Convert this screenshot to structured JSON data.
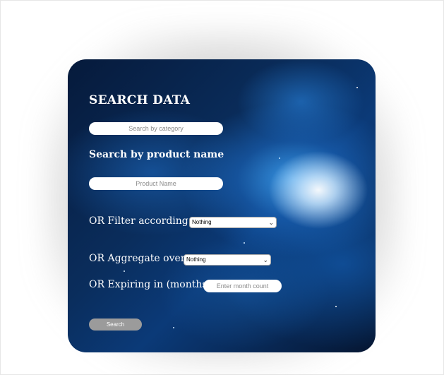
{
  "form": {
    "title": "SEARCH DATA",
    "category_placeholder": "Search by category",
    "product_heading": "Search by product name",
    "product_placeholder": "Product Name",
    "filter_label": "OR Filter according to",
    "filter_selected": "Nothing",
    "aggregate_label": "OR Aggregate over",
    "aggregate_selected": "Nothing",
    "expiry_label": "OR Expiring in (months):",
    "expiry_placeholder": "Enter month count",
    "search_button": "Search"
  },
  "icons": {
    "dropdown": "chevron-down-icon"
  }
}
